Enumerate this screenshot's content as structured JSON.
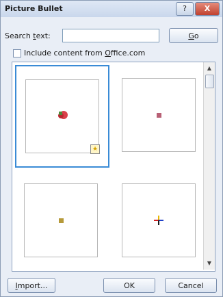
{
  "window": {
    "title": "Picture Bullet",
    "help_glyph": "?",
    "close_glyph": "X"
  },
  "search": {
    "label_pre": "Search ",
    "label_mn": "t",
    "label_post": "ext:",
    "value": "",
    "go_mn": "G",
    "go_post": "o"
  },
  "include": {
    "pre": "Include content from ",
    "mn": "O",
    "post": "ffice.com",
    "checked": false
  },
  "gallery": {
    "items": [
      {
        "name": "red-flower-bullet",
        "selected": true,
        "has_badge": true
      },
      {
        "name": "pink-square-bullet",
        "selected": false,
        "has_badge": false
      },
      {
        "name": "gold-square-bullet",
        "selected": false,
        "has_badge": false
      },
      {
        "name": "colored-cross-bullet",
        "selected": false,
        "has_badge": false
      }
    ],
    "badge_glyph": "★"
  },
  "buttons": {
    "import_mn": "I",
    "import_post": "mport...",
    "ok": "OK",
    "cancel": "Cancel"
  },
  "colors": {
    "accent": "#3a8bd6",
    "titlebar": "#c9d7ec",
    "dialog_bg": "#e9eef6"
  }
}
